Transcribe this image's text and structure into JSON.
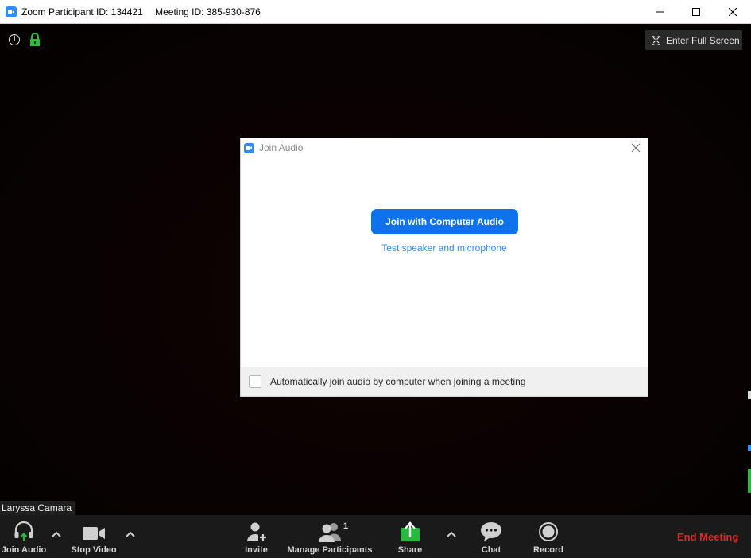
{
  "window": {
    "participant_id": "Zoom Participant ID: 134421",
    "meeting_id": "Meeting ID: 385-930-876"
  },
  "video": {
    "fullscreen_label": "Enter Full Screen",
    "participant_name": "Laryssa Camara"
  },
  "dialog": {
    "title": "Join Audio",
    "join_button": "Join with Computer Audio",
    "test_link": "Test speaker and microphone",
    "auto_join_label": "Automatically join audio by computer when joining a meeting",
    "auto_join_checked": false
  },
  "toolbar": {
    "join_audio": "Join Audio",
    "stop_video": "Stop Video",
    "invite": "Invite",
    "manage_participants": "Manage Participants",
    "participant_count": "1",
    "share": "Share",
    "chat": "Chat",
    "record": "Record",
    "end_meeting": "End Meeting"
  },
  "colors": {
    "accent": "#0e72ed",
    "link": "#2d8cff",
    "share_green": "#27b83f",
    "end_red": "#e02828",
    "lock_green": "#2ebd3a"
  },
  "icons": [
    "zoom-app-icon",
    "minimize-icon",
    "maximize-icon",
    "close-icon",
    "info-icon",
    "lock-icon",
    "fullscreen-icon",
    "headphones-icon",
    "camera-icon",
    "add-user-icon",
    "participants-icon",
    "share-screen-icon",
    "chat-bubble-icon",
    "record-icon",
    "chevron-up-icon"
  ]
}
